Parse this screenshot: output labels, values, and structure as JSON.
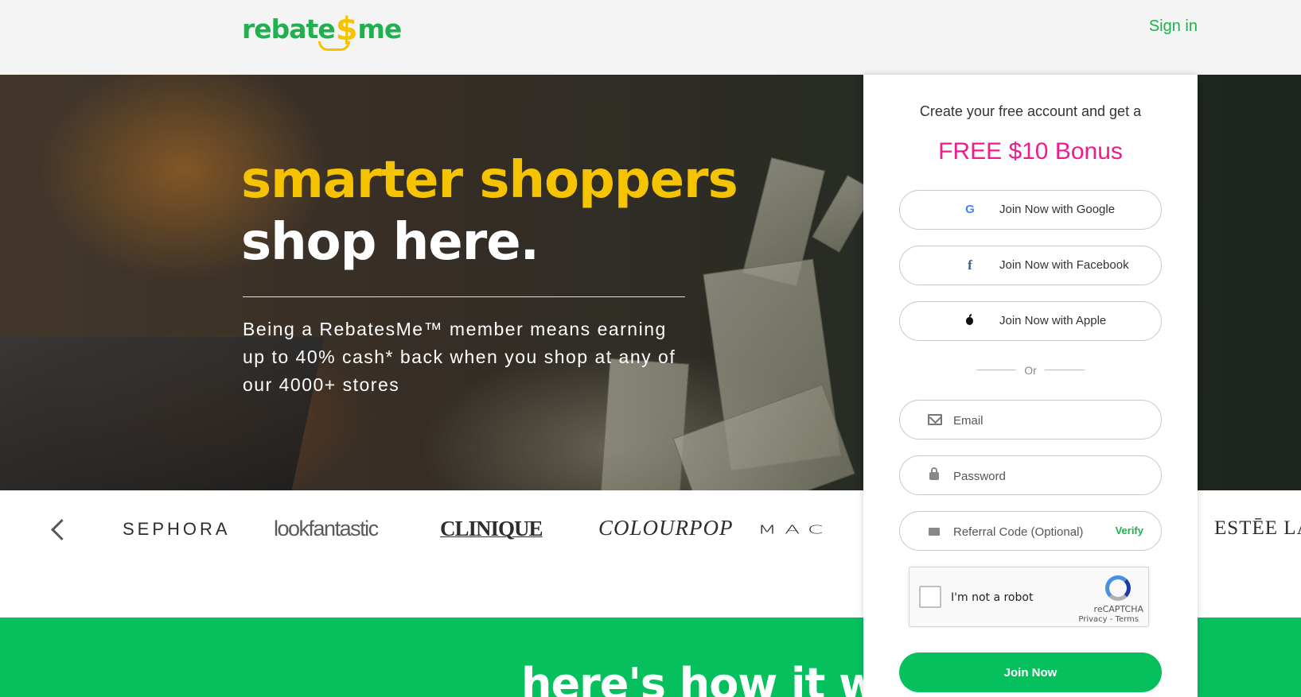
{
  "header": {
    "logo_text_left": "rebate",
    "logo_dollar": "$",
    "logo_text_right": "me",
    "signin_label": "Sign in"
  },
  "hero": {
    "title_line1": "smarter shoppers",
    "title_line2": "shop here.",
    "description": "Being a RebatesMe™ member means earning up to 40% cash* back when you shop at any of our 4000+ stores"
  },
  "brands": {
    "items": [
      "SEPHORA",
      "lookfantastic",
      "CLINIQUE",
      "COLOURPOP",
      "MAC",
      "ESTĒE LAU"
    ]
  },
  "how": {
    "title": "here's how it wor"
  },
  "signup": {
    "intro": "Create your free account and get a",
    "bonus": "FREE $10 Bonus",
    "google_label": "Join Now with Google",
    "facebook_label": "Join Now with Facebook",
    "apple_label": "Join Now with Apple",
    "or_label": "Or",
    "email_placeholder": "Email",
    "password_placeholder": "Password",
    "referral_placeholder": "Referral Code (Optional)",
    "verify_label": "Verify",
    "captcha_label": "I'm not a robot",
    "captcha_brand": "reCAPTCHA",
    "captcha_terms": "Privacy - Terms",
    "join_label": "Join Now"
  },
  "colors": {
    "brand_green": "#06c05d",
    "logo_yellow": "#f6c300",
    "bonus_pink": "#ee1c8c"
  }
}
